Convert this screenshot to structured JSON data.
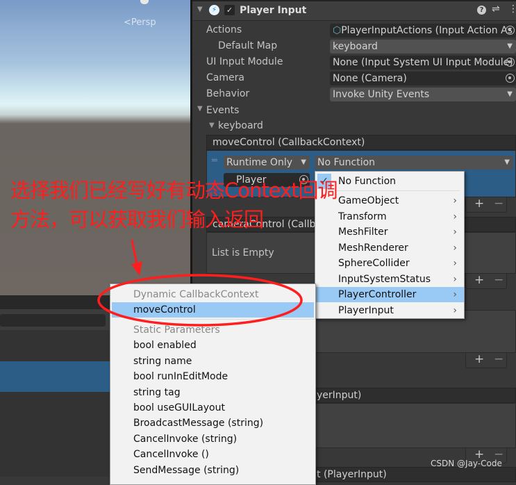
{
  "scene": {
    "persp_label": "<Persp"
  },
  "inspector": {
    "component_title": "Player Input",
    "fields": [
      {
        "label": "Actions",
        "value": "PlayerInputActions (Input Action As"
      },
      {
        "label": "Default Map",
        "value": "keyboard"
      },
      {
        "label": "UI Input Module",
        "value": "None (Input System UI Input Module)"
      },
      {
        "label": "Camera",
        "value": "None (Camera)"
      },
      {
        "label": "Behavior",
        "value": "Invoke Unity Events"
      }
    ],
    "events_label": "Events",
    "keyboard_label": "keyboard",
    "move_event": "moveControl (CallbackContext)",
    "runtime_option": "Runtime Only",
    "function_value": "No Function",
    "object_value": "Player",
    "camera_event": "cameraControl (Callba",
    "list_empty": "List is Empty",
    "event3_partial": "yerInput)",
    "event4_partial": "t (PlayerInput)",
    "plus": "+",
    "minus": "−"
  },
  "function_menu": {
    "items": [
      {
        "label": "No Function",
        "checked": true
      },
      {
        "label": "GameObject"
      },
      {
        "label": "Transform"
      },
      {
        "label": "MeshFilter"
      },
      {
        "label": "MeshRenderer"
      },
      {
        "label": "SphereCollider"
      },
      {
        "label": "InputSystemStatus"
      },
      {
        "label": "PlayerController",
        "highlighted": true
      },
      {
        "label": "PlayerInput"
      }
    ]
  },
  "method_menu": {
    "dynamic_header": "Dynamic CallbackContext",
    "dynamic_item": "moveControl",
    "static_header": "Static Parameters",
    "static_items": [
      "bool enabled",
      "string name",
      "bool runInEditMode",
      "string tag",
      "bool useGUILayout",
      "BroadcastMessage (string)",
      "CancelInvoke (string)",
      "CancelInvoke ()",
      "SendMessage (string)"
    ]
  },
  "annotation": {
    "line1": "选择我们已经写好有动态Context回调",
    "line2": "方法，可以获取我们输入返回",
    "color": "#ff1e1e"
  },
  "watermark": "CSDN @Jay-Code"
}
